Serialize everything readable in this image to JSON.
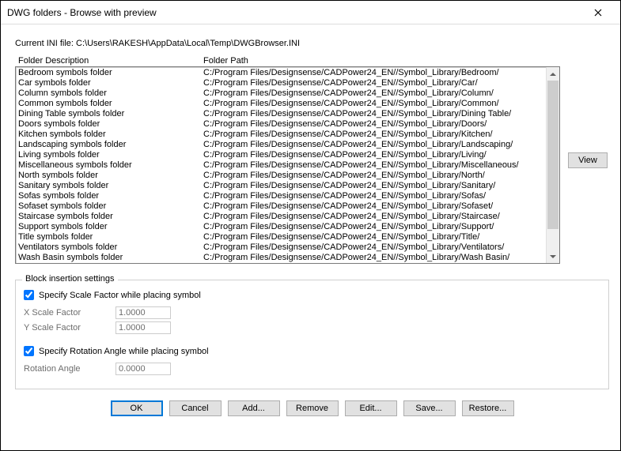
{
  "window": {
    "title": "DWG folders - Browse with preview"
  },
  "iniLine": "Current INI file: C:\\Users\\RAKESH\\AppData\\Local\\Temp\\DWGBrowser.INI",
  "headers": {
    "desc": "Folder Description",
    "path": "Folder Path"
  },
  "folders": [
    {
      "desc": "Bedroom symbols folder",
      "path": "C:/Program Files/Designsense/CADPower24_EN//Symbol_Library/Bedroom/"
    },
    {
      "desc": "Car symbols folder",
      "path": "C:/Program Files/Designsense/CADPower24_EN//Symbol_Library/Car/"
    },
    {
      "desc": "Column symbols folder",
      "path": "C:/Program Files/Designsense/CADPower24_EN//Symbol_Library/Column/"
    },
    {
      "desc": "Common symbols folder",
      "path": "C:/Program Files/Designsense/CADPower24_EN//Symbol_Library/Common/"
    },
    {
      "desc": "Dining Table symbols folder",
      "path": "C:/Program Files/Designsense/CADPower24_EN//Symbol_Library/Dining Table/"
    },
    {
      "desc": "Doors symbols folder",
      "path": "C:/Program Files/Designsense/CADPower24_EN//Symbol_Library/Doors/"
    },
    {
      "desc": "Kitchen symbols folder",
      "path": "C:/Program Files/Designsense/CADPower24_EN//Symbol_Library/Kitchen/"
    },
    {
      "desc": "Landscaping symbols folder",
      "path": "C:/Program Files/Designsense/CADPower24_EN//Symbol_Library/Landscaping/"
    },
    {
      "desc": "Living symbols folder",
      "path": "C:/Program Files/Designsense/CADPower24_EN//Symbol_Library/Living/"
    },
    {
      "desc": "Miscellaneous symbols folder",
      "path": "C:/Program Files/Designsense/CADPower24_EN//Symbol_Library/Miscellaneous/"
    },
    {
      "desc": "North symbols folder",
      "path": "C:/Program Files/Designsense/CADPower24_EN//Symbol_Library/North/"
    },
    {
      "desc": "Sanitary symbols folder",
      "path": "C:/Program Files/Designsense/CADPower24_EN//Symbol_Library/Sanitary/"
    },
    {
      "desc": "Sofas symbols folder",
      "path": "C:/Program Files/Designsense/CADPower24_EN//Symbol_Library/Sofas/"
    },
    {
      "desc": "Sofaset symbols folder",
      "path": "C:/Program Files/Designsense/CADPower24_EN//Symbol_Library/Sofaset/"
    },
    {
      "desc": "Staircase symbols folder",
      "path": "C:/Program Files/Designsense/CADPower24_EN//Symbol_Library/Staircase/"
    },
    {
      "desc": "Support symbols folder",
      "path": "C:/Program Files/Designsense/CADPower24_EN//Symbol_Library/Support/"
    },
    {
      "desc": "Title symbols folder",
      "path": "C:/Program Files/Designsense/CADPower24_EN//Symbol_Library/Title/"
    },
    {
      "desc": "Ventilators symbols folder",
      "path": "C:/Program Files/Designsense/CADPower24_EN//Symbol_Library/Ventilators/"
    },
    {
      "desc": "Wash Basin symbols folder",
      "path": "C:/Program Files/Designsense/CADPower24_EN//Symbol_Library/Wash Basin/"
    }
  ],
  "viewButton": "View",
  "blockSettings": {
    "legend": "Block insertion settings",
    "scaleCheck": "Specify Scale Factor while placing symbol",
    "xScaleLabel": "X Scale Factor",
    "xScaleValue": "1.0000",
    "yScaleLabel": "Y Scale Factor",
    "yScaleValue": "1.0000",
    "rotCheck": "Specify Rotation Angle while placing symbol",
    "rotLabel": "Rotation Angle",
    "rotValue": "0.0000"
  },
  "buttons": {
    "ok": "OK",
    "cancel": "Cancel",
    "add": "Add...",
    "remove": "Remove",
    "edit": "Edit...",
    "save": "Save...",
    "restore": "Restore..."
  }
}
